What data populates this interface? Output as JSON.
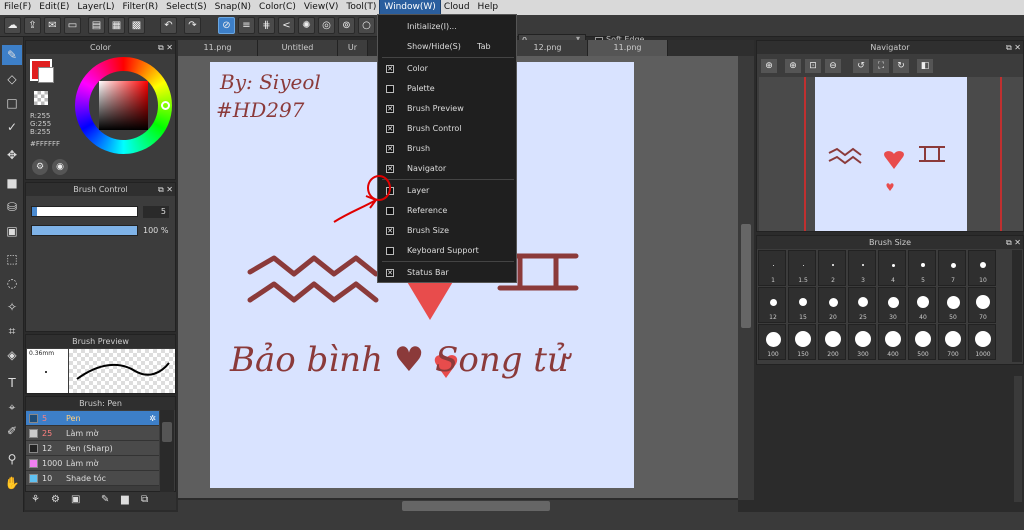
{
  "menubar": {
    "items": [
      "File(F)",
      "Edit(E)",
      "Layer(L)",
      "Filter(R)",
      "Select(S)",
      "Snap(N)",
      "Color(C)",
      "View(V)",
      "Tool(T)",
      "Window(W)",
      "Cloud",
      "Help"
    ],
    "active": "Window(W)"
  },
  "toolbar": {
    "soft_edge_label": "Soft Edge",
    "brush_size_value": "0"
  },
  "tabs": [
    {
      "label": "11.png"
    },
    {
      "label": "Untitled"
    },
    {
      "label": "Ur"
    },
    {
      "label": "12.png"
    },
    {
      "label": "11.png"
    }
  ],
  "color_panel": {
    "title": "Color",
    "r": "R:255",
    "g": "G:255",
    "b": "B:255",
    "hex": "#FFFFFF",
    "fg_color": "#e02020",
    "bg_color": "#ffffff"
  },
  "brush_control": {
    "title": "Brush Control",
    "size_value": "5",
    "opacity_value": "100 %"
  },
  "brush_preview": {
    "title": "Brush Preview",
    "size_label": "0.36mm"
  },
  "brush_list": {
    "title": "Brush: Pen",
    "rows": [
      {
        "num": "5",
        "name": "Pen",
        "color": "#1f4e79",
        "selected": true
      },
      {
        "num": "25",
        "name": "Làm mờ",
        "color": "#cccccc",
        "selected": false
      },
      {
        "num": "12",
        "name": "Pen (Sharp)",
        "color": "#222222",
        "selected": false
      },
      {
        "num": "1000",
        "name": "Làm mờ",
        "color": "#f080f0",
        "selected": false
      },
      {
        "num": "10",
        "name": "Shade tóc",
        "color": "#60c0f0",
        "selected": false
      }
    ]
  },
  "window_menu": {
    "items": [
      {
        "label": "Initialize(I)...",
        "shortcut": "",
        "check": null
      },
      {
        "label": "Show/Hide(S)",
        "shortcut": "Tab",
        "check": null
      },
      {
        "label": "Color",
        "shortcut": "",
        "check": true
      },
      {
        "label": "Palette",
        "shortcut": "",
        "check": false
      },
      {
        "label": "Brush Preview",
        "shortcut": "",
        "check": true
      },
      {
        "label": "Brush Control",
        "shortcut": "",
        "check": true
      },
      {
        "label": "Brush",
        "shortcut": "",
        "check": true
      },
      {
        "label": "Navigator",
        "shortcut": "",
        "check": true
      },
      {
        "label": "Layer",
        "shortcut": "",
        "check": false
      },
      {
        "label": "Reference",
        "shortcut": "",
        "check": false
      },
      {
        "label": "Brush Size",
        "shortcut": "",
        "check": true
      },
      {
        "label": "Keyboard Support",
        "shortcut": "",
        "check": false
      },
      {
        "label": "Status Bar",
        "shortcut": "",
        "check": true
      }
    ]
  },
  "navigator": {
    "title": "Navigator"
  },
  "brush_size_panel": {
    "title": "Brush Size",
    "sizes": [
      "1",
      "1.5",
      "2",
      "3",
      "4",
      "5",
      "7",
      "10",
      "12",
      "15",
      "20",
      "25",
      "30",
      "40",
      "50",
      "70",
      "100",
      "150",
      "200",
      "300",
      "400",
      "500",
      "700",
      "1000"
    ]
  },
  "artwork": {
    "credit_line1": "By: Siyeol",
    "credit_line2": "#HD297",
    "caption": "Bảo bình ♥ Song tử"
  },
  "accent_colors": {
    "highlight": "#3d7fc8",
    "annotation_red": "#e00000",
    "ink": "#8b3a3a",
    "heart": "#e84c4c"
  }
}
